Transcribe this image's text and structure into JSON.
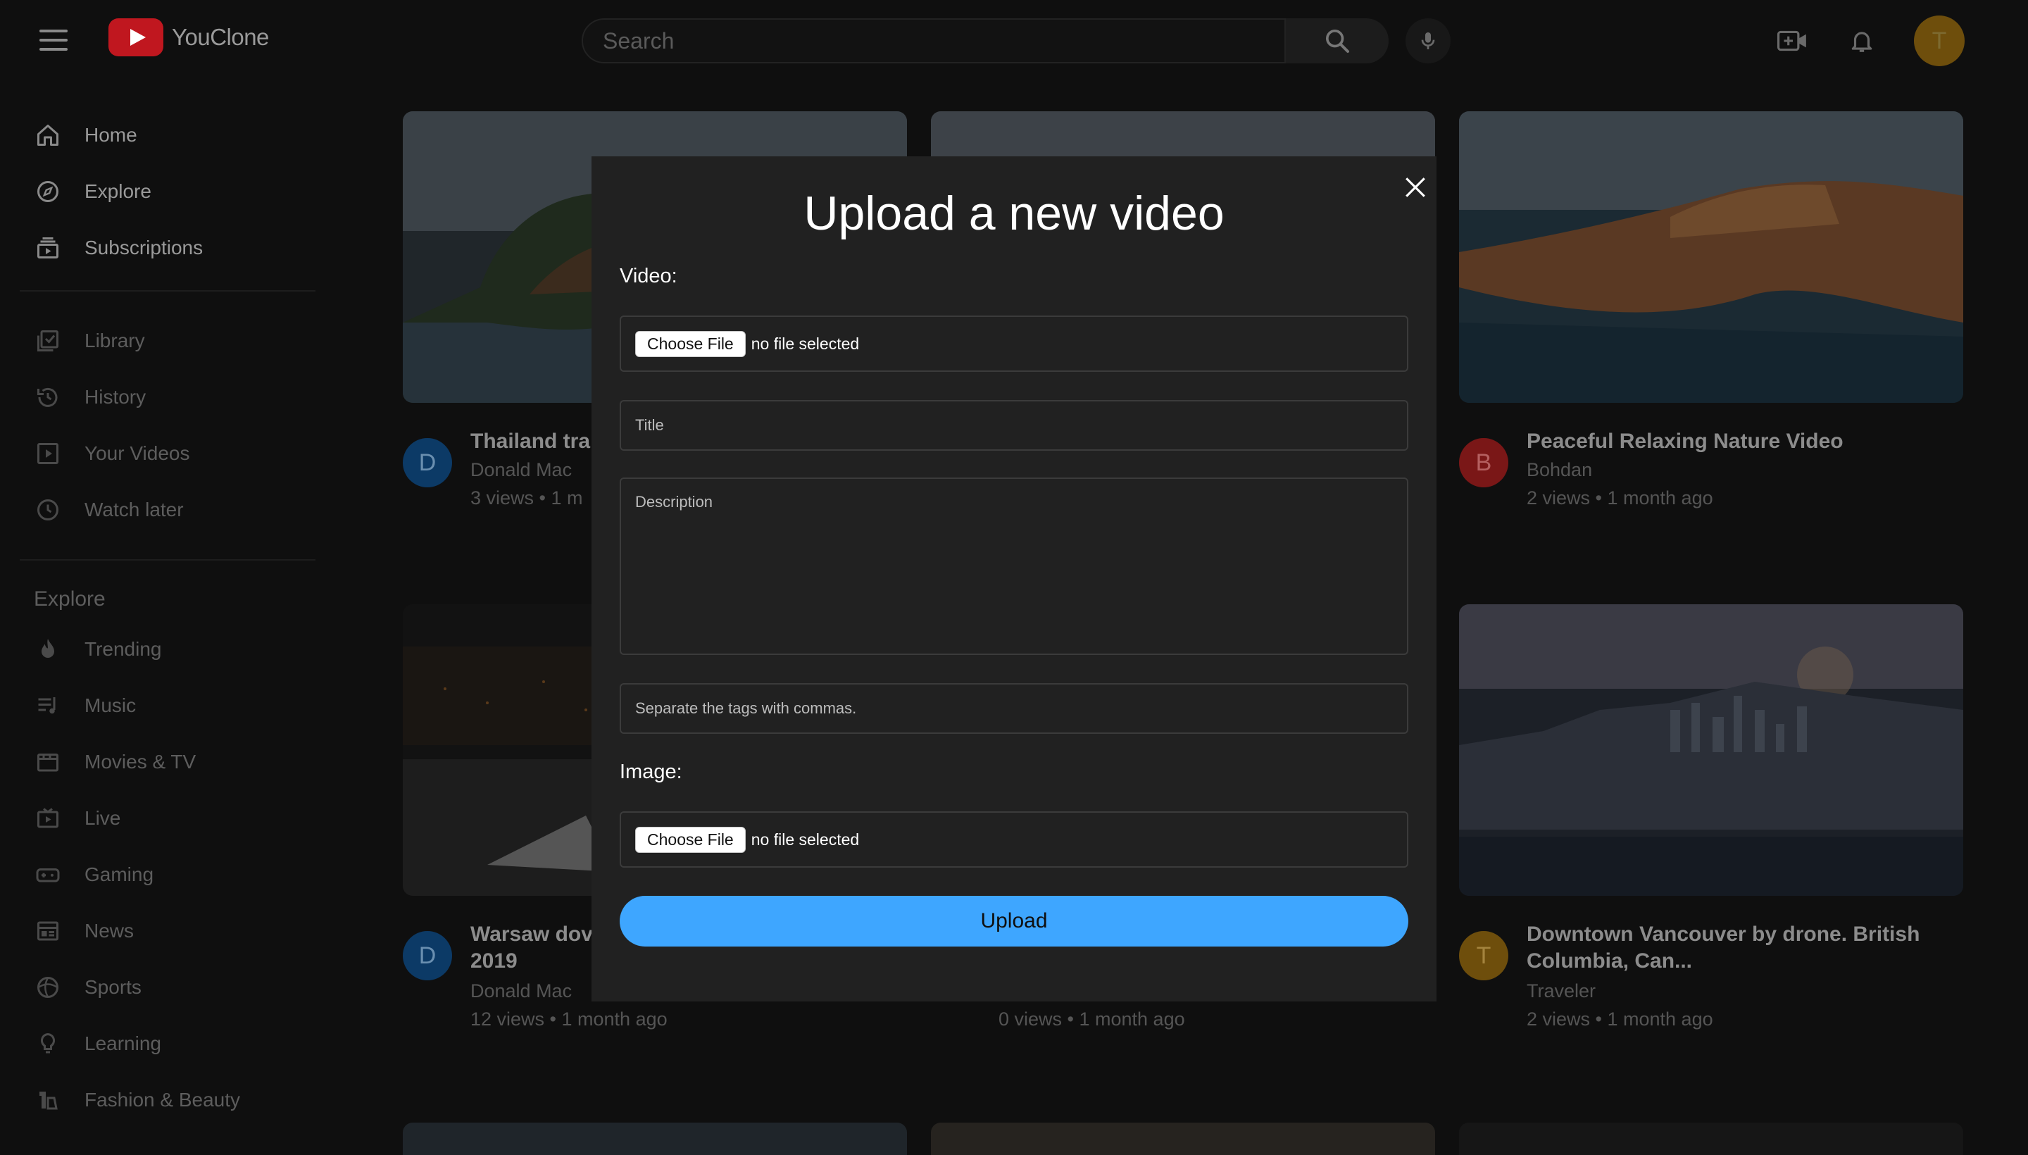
{
  "app": {
    "brand_name": "YouClone"
  },
  "search": {
    "placeholder": "Search"
  },
  "user": {
    "avatar_initial": "T"
  },
  "sidebar": {
    "main": [
      {
        "label": "Home",
        "icon": "home-icon"
      },
      {
        "label": "Explore",
        "icon": "compass-icon"
      },
      {
        "label": "Subscriptions",
        "icon": "subscriptions-icon"
      }
    ],
    "library": [
      {
        "label": "Library",
        "icon": "library-icon"
      },
      {
        "label": "History",
        "icon": "history-icon"
      },
      {
        "label": "Your Videos",
        "icon": "your-videos-icon"
      },
      {
        "label": "Watch later",
        "icon": "clock-icon"
      }
    ],
    "explore_heading": "Explore",
    "explore": [
      {
        "label": "Trending",
        "icon": "flame-icon"
      },
      {
        "label": "Music",
        "icon": "music-icon"
      },
      {
        "label": "Movies & TV",
        "icon": "film-icon"
      },
      {
        "label": "Live",
        "icon": "live-icon"
      },
      {
        "label": "Gaming",
        "icon": "gamepad-icon"
      },
      {
        "label": "News",
        "icon": "news-icon"
      },
      {
        "label": "Sports",
        "icon": "trophy-icon"
      },
      {
        "label": "Learning",
        "icon": "lightbulb-icon"
      },
      {
        "label": "Fashion & Beauty",
        "icon": "hanger-icon"
      }
    ]
  },
  "videos": [
    {
      "title": "Thailand tra",
      "channel": "Donald Mac",
      "stats": "3 views • 1 m",
      "avatar": "D",
      "avatar_color": "#0c3a66"
    },
    {
      "title": "",
      "channel": "",
      "stats": "",
      "avatar": "",
      "avatar_color": "#333333"
    },
    {
      "title": "Peaceful Relaxing Nature Video",
      "channel": "Bohdan",
      "stats": "2 views • 1 month ago",
      "avatar": "B",
      "avatar_color": "#7a1717"
    },
    {
      "title": "Warsaw dov",
      "title_line2": "2019",
      "channel": "Donald Mac",
      "stats": "12 views • 1 month ago",
      "avatar": "D",
      "avatar_color": "#0c3a66"
    },
    {
      "title": "",
      "channel": "",
      "stats": "0 views • 1 month ago",
      "avatar": "",
      "avatar_color": "#333333"
    },
    {
      "title": "Downtown Vancouver by drone. British Columbia, Can...",
      "channel": "Traveler",
      "stats": "2 views • 1 month ago",
      "avatar": "T",
      "avatar_color": "#6e4e0c"
    }
  ],
  "modal": {
    "title": "Upload a new video",
    "video_label": "Video:",
    "choose_file_label": "Choose File",
    "no_file_text": "no file selected",
    "title_placeholder": "Title",
    "description_placeholder": "Description",
    "tags_placeholder": "Separate the tags with commas.",
    "image_label": "Image:",
    "upload_label": "Upload"
  }
}
